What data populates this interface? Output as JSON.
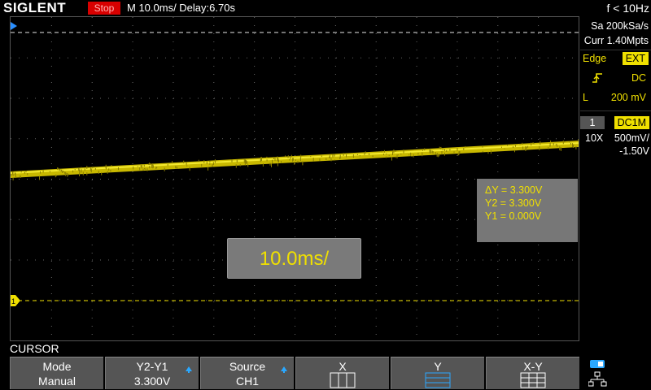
{
  "header": {
    "brand": "SIGLENT",
    "run_state": "Stop",
    "timebase": "M 10.0ms/ Delay:6.70s",
    "frequency": "f < 10Hz"
  },
  "acquisition": {
    "sample_rate": "Sa 200kSa/s",
    "memory_depth": "Curr 1.40Mpts"
  },
  "trigger": {
    "type": "Edge",
    "source": "EXT",
    "slope_icon": "rising-edge-icon",
    "coupling": "DC",
    "level_prefix": "L",
    "level": "200 mV"
  },
  "channel1": {
    "number": "1",
    "coupling": "DC1M",
    "probe": "10X",
    "scale": "500mV/",
    "offset": "-1.50V",
    "marker": "1",
    "color": "#f0e000"
  },
  "cursor_info": {
    "delta_y": "ΔY = 3.300V",
    "y2": "Y2 = 3.300V",
    "y1": "Y1 = 0.000V"
  },
  "timebase_popup": "10.0ms/",
  "menu": {
    "title": "CURSOR",
    "softkeys": [
      {
        "top": "Mode",
        "bottom": "Manual"
      },
      {
        "top": "Y2-Y1",
        "bottom": "3.300V"
      },
      {
        "top": "Source",
        "bottom": "CH1"
      },
      {
        "top": "X",
        "bottom": ""
      },
      {
        "top": "Y",
        "bottom": ""
      },
      {
        "top": "X-Y",
        "bottom": ""
      }
    ]
  }
}
